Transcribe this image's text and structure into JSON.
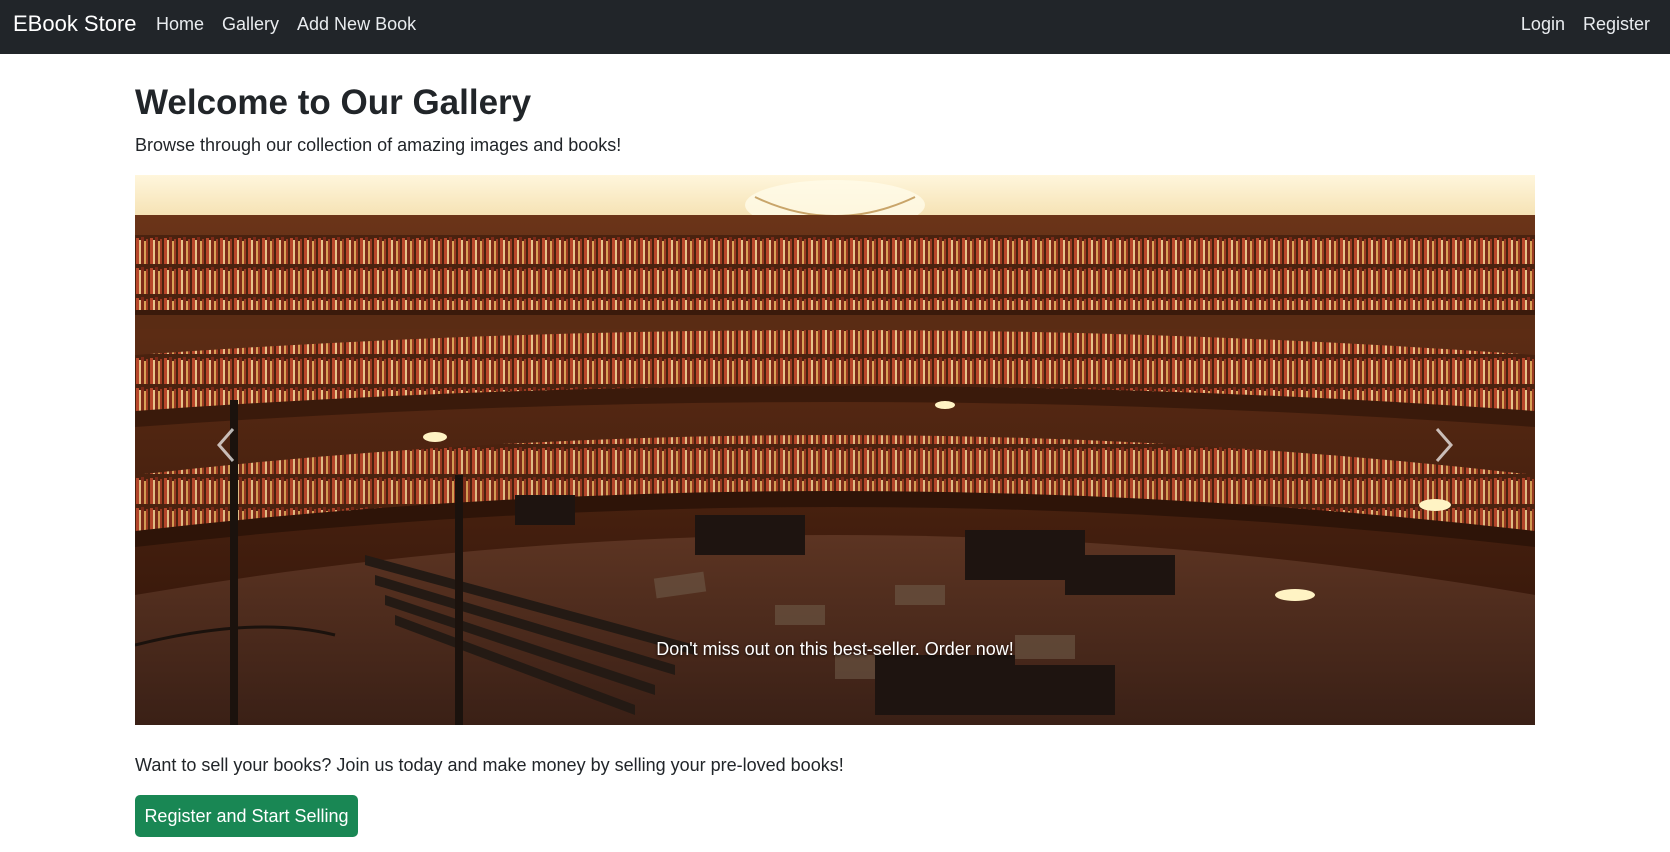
{
  "navbar": {
    "brand": "EBook Store",
    "links": [
      "Home",
      "Gallery",
      "Add New Book"
    ],
    "right_links": [
      "Login",
      "Register"
    ]
  },
  "main": {
    "title": "Welcome to Our Gallery",
    "subtitle": "Browse through our collection of amazing images and books!",
    "carousel": {
      "caption": "Don't miss out on this best-seller. Order now!",
      "prev_icon": "chevron-left-icon",
      "next_icon": "chevron-right-icon"
    },
    "promo_text": "Want to sell your books? Join us today and make money by selling your pre-loved books!",
    "cta_label": "Register and Start Selling"
  },
  "colors": {
    "navbar_bg": "#212529",
    "cta_green": "#198754",
    "text": "#212529"
  }
}
